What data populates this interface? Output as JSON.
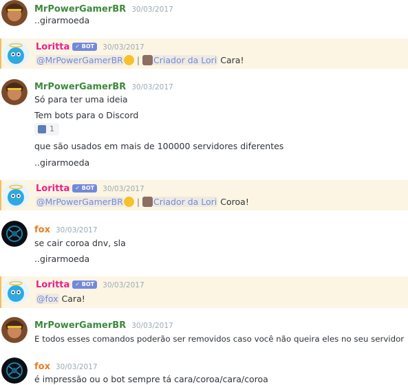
{
  "colors": {
    "mrpower": "#3c8a3c",
    "loritta": "#e91e8c",
    "fox": "#e67e22",
    "mention_bg": "#fcf5e4",
    "bot_badge": "#7289da"
  },
  "bot_badge": "✓ BOT",
  "messages": [
    {
      "user": "MrPowerGamerBR",
      "time": "30/03/2017",
      "lines": [
        "..girarmoeda"
      ]
    },
    {
      "user": "Loritta",
      "bot": true,
      "time": "30/03/2017",
      "mention": "@MrPowerGamerBR",
      "sep": " | ",
      "role": "Criador da Lori",
      "text": " Cara!"
    },
    {
      "user": "MrPowerGamerBR",
      "time": "30/03/2017",
      "lines": [
        "Só para ter uma ideia",
        "Tem bots para o Discord"
      ],
      "reaction": {
        "icon": "computer-emoji",
        "count": "1"
      },
      "lines_after": [
        "que são usados em mais de 100000 servidores diferentes",
        "..girarmoeda"
      ]
    },
    {
      "user": "Loritta",
      "bot": true,
      "time": "30/03/2017",
      "mention": "@MrPowerGamerBR",
      "sep": " | ",
      "role": "Criador da Lori",
      "text": " Coroa!"
    },
    {
      "user": "fox",
      "time": "30/03/2017",
      "lines": [
        "se cair coroa dnv, sla",
        "..girarmoeda"
      ]
    },
    {
      "user": "Loritta",
      "bot": true,
      "time": "30/03/2017",
      "mention": "@fox",
      "text": " Cara!"
    },
    {
      "user": "MrPowerGamerBR",
      "time": "30/03/2017",
      "lines": [
        "E todos esses comandos poderão ser removidos caso você não queira eles no seu servidor"
      ]
    },
    {
      "user": "fox",
      "time": "30/03/2017",
      "lines": [
        "é impressão ou o bot sempre tá cara/coroa/cara/coroa"
      ]
    }
  ]
}
